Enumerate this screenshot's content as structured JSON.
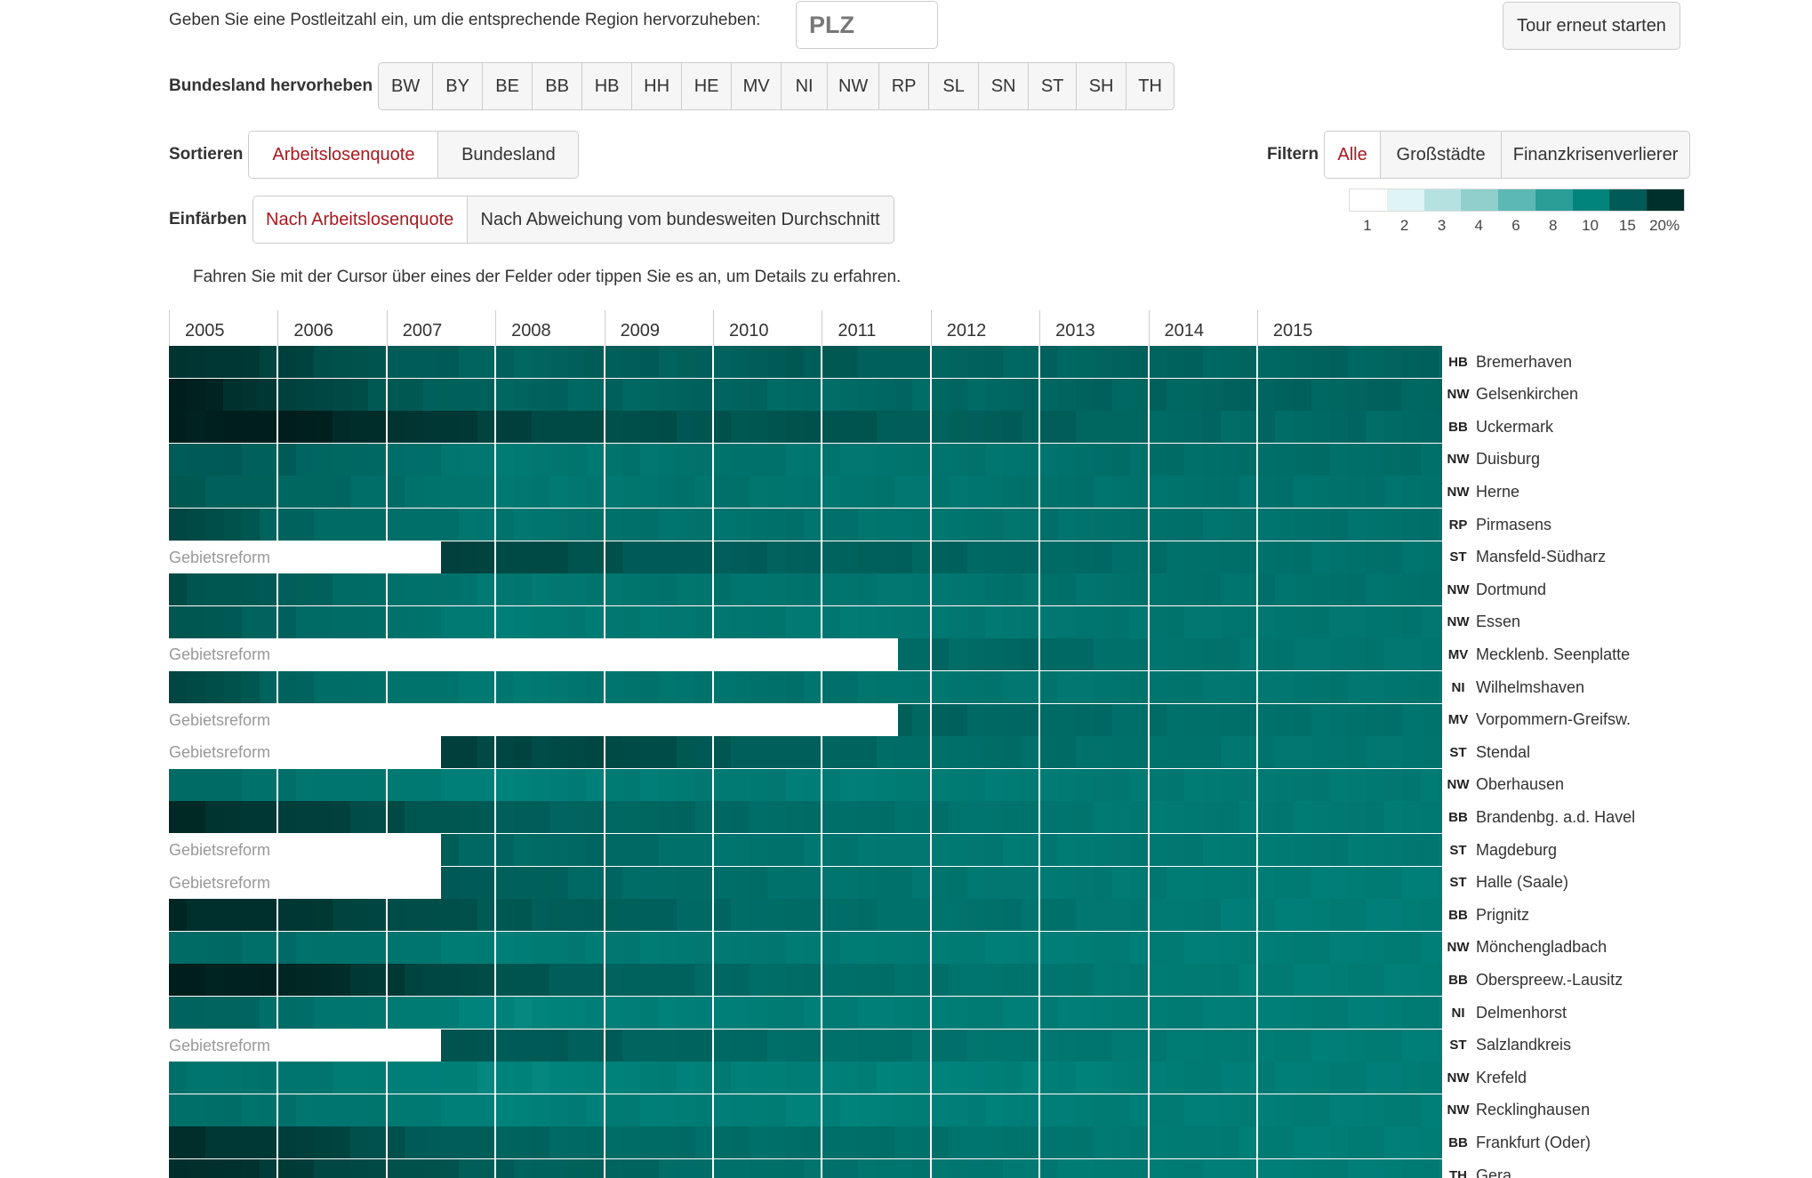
{
  "plz": {
    "prompt": "Geben Sie eine Postleitzahl ein, um die entsprechende Region hervorzuheben:",
    "placeholder": "PLZ"
  },
  "tour_button": "Tour erneut starten",
  "highlight": {
    "label": "Bundesland hervorheben",
    "states": [
      "BW",
      "BY",
      "BE",
      "BB",
      "HB",
      "HH",
      "HE",
      "MV",
      "NI",
      "NW",
      "RP",
      "SL",
      "SN",
      "ST",
      "SH",
      "TH"
    ]
  },
  "sort": {
    "label": "Sortieren",
    "options": [
      "Arbeitslosenquote",
      "Bundesland"
    ],
    "active": "Arbeitslosenquote"
  },
  "filter": {
    "label": "Filtern",
    "options": [
      "Alle",
      "Großstädte",
      "Finanzkrisenverlierer"
    ],
    "active": "Alle"
  },
  "color_by": {
    "label": "Einfärben",
    "options": [
      "Nach Arbeitslosenquote",
      "Nach Abweichung vom bundesweiten Durchschnitt"
    ],
    "active": "Nach Arbeitslosenquote"
  },
  "legend": {
    "labels": [
      "1",
      "2",
      "3",
      "4",
      "6",
      "8",
      "10",
      "15",
      "20%"
    ],
    "colors": [
      "#ffffff",
      "#dff4f4",
      "#b6e1e1",
      "#8fd0cd",
      "#5cb8b2",
      "#2a9e97",
      "#00847c",
      "#005a55",
      "#00302c"
    ]
  },
  "hint": "Fahren Sie mit der Cursor über eines der Felder oder tippen Sie es an, um Details zu erfahren.",
  "reform_label": "Gebietsreform",
  "chart_data": {
    "type": "heatmap",
    "x": [
      "2005",
      "2006",
      "2007",
      "2008",
      "2009",
      "2010",
      "2011",
      "2012",
      "2013",
      "2014",
      "2015"
    ],
    "value_unit": "Arbeitslosenquote %",
    "rows": [
      {
        "state": "HB",
        "name": "Bremerhaven",
        "values": [
          18.5,
          17.0,
          15.0,
          14.0,
          14.5,
          14.5,
          15.0,
          14.0,
          14.0,
          14.0,
          14.0
        ],
        "reform_until": null
      },
      {
        "state": "NW",
        "name": "Gelsenkirchen",
        "values": [
          20.0,
          17.5,
          15.0,
          14.0,
          14.0,
          14.0,
          13.5,
          13.5,
          14.0,
          14.0,
          14.0
        ],
        "reform_until": null
      },
      {
        "state": "BB",
        "name": "Uckermark",
        "values": [
          20.0,
          20.0,
          18.5,
          17.0,
          16.0,
          15.5,
          15.5,
          14.5,
          14.5,
          13.5,
          13.5
        ],
        "reform_until": null
      },
      {
        "state": "NW",
        "name": "Duisburg",
        "values": [
          15.0,
          14.5,
          13.0,
          11.5,
          12.0,
          12.5,
          12.0,
          12.0,
          12.5,
          13.0,
          13.0
        ],
        "reform_until": null
      },
      {
        "state": "NW",
        "name": "Herne",
        "values": [
          15.0,
          14.0,
          13.0,
          11.5,
          12.0,
          12.5,
          12.0,
          12.0,
          12.5,
          12.5,
          12.5
        ],
        "reform_until": null
      },
      {
        "state": "RP",
        "name": "Pirmasens",
        "values": [
          17.0,
          14.0,
          13.0,
          12.0,
          12.5,
          12.5,
          12.5,
          12.0,
          12.5,
          12.5,
          12.5
        ],
        "reform_until": null
      },
      {
        "state": "ST",
        "name": "Mansfeld-Südharz",
        "values": [
          null,
          null,
          18.0,
          16.5,
          15.5,
          14.5,
          14.5,
          14.0,
          13.5,
          13.0,
          12.5
        ],
        "reform_until": 2007.5
      },
      {
        "state": "NW",
        "name": "Dortmund",
        "values": [
          16.0,
          14.5,
          13.0,
          11.5,
          12.0,
          12.5,
          12.0,
          12.0,
          12.5,
          12.5,
          12.5
        ],
        "reform_until": null
      },
      {
        "state": "NW",
        "name": "Essen",
        "values": [
          15.5,
          14.0,
          12.5,
          11.0,
          11.5,
          12.0,
          11.5,
          11.5,
          12.0,
          12.0,
          12.0
        ],
        "reform_until": null
      },
      {
        "state": "MV",
        "name": "Mecklenb. Seenplatte",
        "values": [
          null,
          null,
          null,
          null,
          null,
          null,
          14.0,
          13.5,
          13.5,
          12.5,
          12.0
        ],
        "reform_until": 2011.7
      },
      {
        "state": "NI",
        "name": "Wilhelmshaven",
        "values": [
          17.0,
          14.0,
          12.5,
          11.5,
          12.0,
          12.5,
          12.5,
          12.0,
          12.0,
          12.0,
          12.0
        ],
        "reform_until": null
      },
      {
        "state": "MV",
        "name": "Vorpommern-Greifsw.",
        "values": [
          null,
          null,
          null,
          null,
          null,
          null,
          14.5,
          14.0,
          13.5,
          13.0,
          12.5
        ],
        "reform_until": 2011.7
      },
      {
        "state": "ST",
        "name": "Stendal",
        "values": [
          null,
          null,
          17.5,
          16.5,
          16.5,
          15.0,
          14.0,
          13.0,
          13.0,
          12.5,
          12.0
        ],
        "reform_until": 2007.5
      },
      {
        "state": "NW",
        "name": "Oberhausen",
        "values": [
          13.5,
          12.5,
          11.5,
          10.5,
          11.0,
          11.5,
          11.0,
          11.0,
          11.5,
          11.5,
          11.5
        ],
        "reform_until": null
      },
      {
        "state": "BB",
        "name": "Brandenbg. a.d. Havel",
        "values": [
          19.0,
          17.5,
          16.0,
          14.5,
          14.0,
          13.5,
          13.0,
          12.5,
          12.0,
          11.5,
          11.5
        ],
        "reform_until": null
      },
      {
        "state": "ST",
        "name": "Magdeburg",
        "values": [
          null,
          null,
          15.0,
          13.5,
          13.5,
          12.5,
          12.0,
          11.5,
          11.5,
          11.5,
          11.5
        ],
        "reform_until": 2007.5
      },
      {
        "state": "ST",
        "name": "Halle (Saale)",
        "values": [
          null,
          null,
          16.0,
          14.5,
          13.5,
          13.0,
          12.5,
          12.0,
          11.5,
          11.5,
          11.0
        ],
        "reform_until": 2007.5
      },
      {
        "state": "BB",
        "name": "Prignitz",
        "values": [
          19.0,
          18.0,
          16.5,
          15.0,
          14.5,
          13.5,
          13.0,
          12.5,
          12.5,
          11.5,
          11.0
        ],
        "reform_until": null
      },
      {
        "state": "NW",
        "name": "Mönchengladbach",
        "values": [
          13.5,
          13.0,
          12.0,
          11.0,
          11.5,
          11.5,
          11.5,
          11.0,
          11.0,
          11.0,
          11.0
        ],
        "reform_until": null
      },
      {
        "state": "BB",
        "name": "Oberspreew.-Lausitz",
        "values": [
          20.0,
          19.5,
          17.5,
          15.5,
          14.5,
          13.5,
          13.0,
          12.5,
          12.0,
          11.5,
          11.0
        ],
        "reform_until": null
      },
      {
        "state": "NI",
        "name": "Delmenhorst",
        "values": [
          14.5,
          13.0,
          11.5,
          10.0,
          10.5,
          11.0,
          11.0,
          11.0,
          11.0,
          11.0,
          11.0
        ],
        "reform_until": null
      },
      {
        "state": "ST",
        "name": "Salzlandkreis",
        "values": [
          null,
          null,
          16.5,
          15.0,
          14.5,
          13.5,
          13.0,
          12.5,
          12.0,
          11.5,
          11.0
        ],
        "reform_until": 2007.5
      },
      {
        "state": "NW",
        "name": "Krefeld",
        "values": [
          12.5,
          12.0,
          11.0,
          10.0,
          10.5,
          11.0,
          10.5,
          10.5,
          10.5,
          11.0,
          11.0
        ],
        "reform_until": null
      },
      {
        "state": "NW",
        "name": "Recklinghausen",
        "values": [
          13.0,
          12.5,
          11.5,
          10.5,
          11.0,
          11.0,
          10.5,
          10.5,
          11.0,
          11.0,
          11.0
        ],
        "reform_until": null
      },
      {
        "state": "BB",
        "name": "Frankfurt (Oder)",
        "values": [
          18.5,
          17.5,
          15.5,
          14.0,
          13.5,
          13.0,
          13.0,
          12.5,
          12.0,
          11.5,
          11.0
        ],
        "reform_until": null
      },
      {
        "state": "TH",
        "name": "Gera",
        "values": [
          19.0,
          17.5,
          16.0,
          14.5,
          14.0,
          13.0,
          12.5,
          12.0,
          11.5,
          11.0,
          11.0
        ],
        "reform_until": null
      }
    ]
  }
}
